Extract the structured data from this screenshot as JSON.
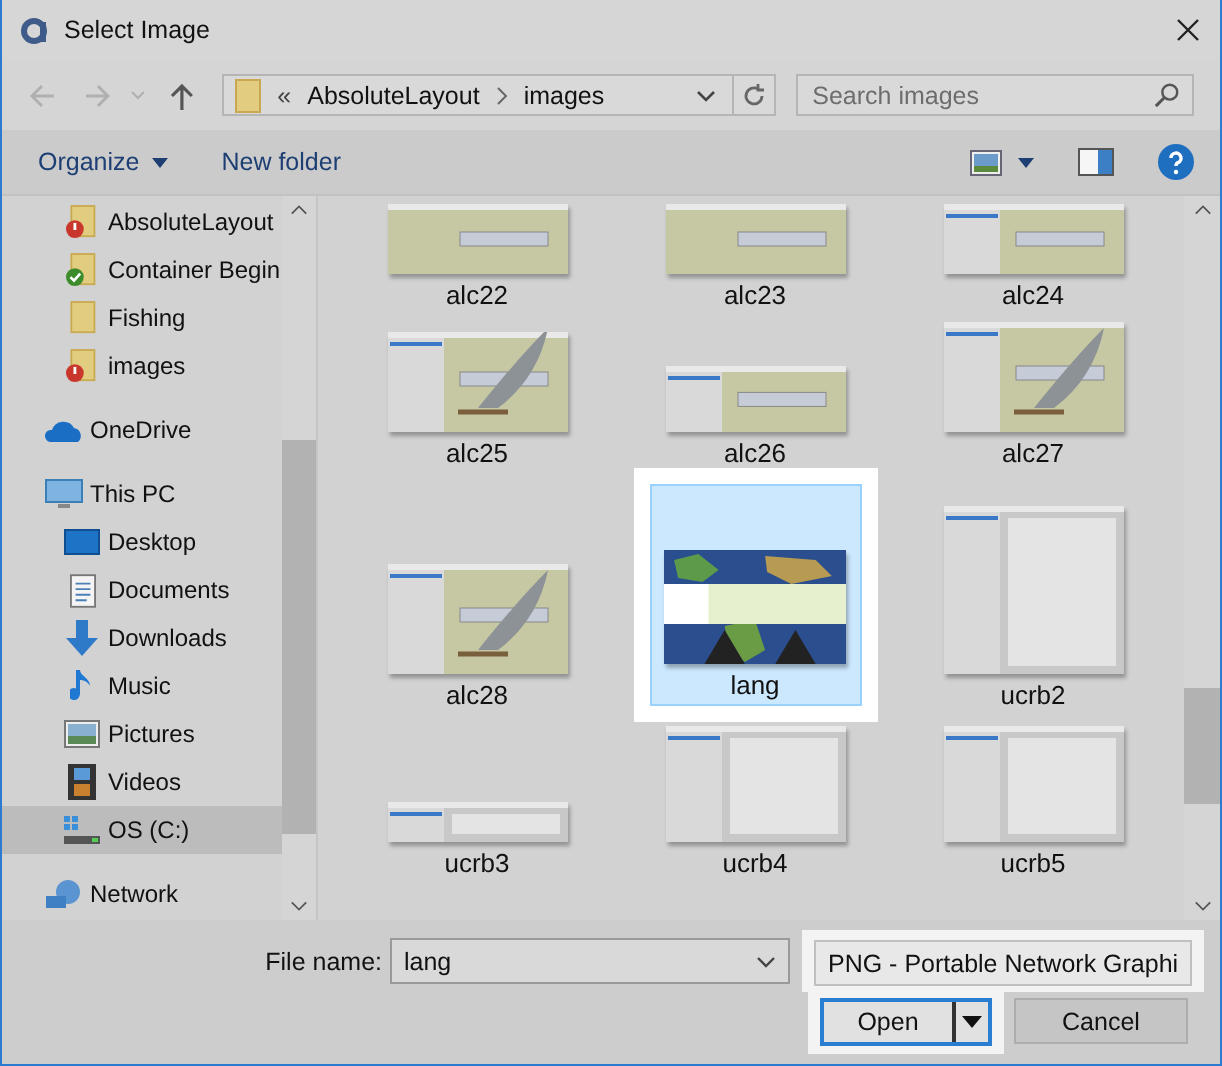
{
  "window": {
    "title": "Select Image"
  },
  "address": {
    "crumbs": [
      "«",
      "AbsoluteLayout",
      "images"
    ]
  },
  "search": {
    "placeholder": "Search images"
  },
  "toolbar": {
    "organize": "Organize",
    "new_folder": "New folder"
  },
  "sidebar": {
    "sections": [
      {
        "children": [
          {
            "label": "AbsoluteLayout",
            "kind": "folder-error",
            "selected": false
          },
          {
            "label": "Container Begin",
            "kind": "folder-ok",
            "selected": false
          },
          {
            "label": "Fishing",
            "kind": "folder",
            "selected": false
          },
          {
            "label": "images",
            "kind": "folder-error",
            "selected": false
          }
        ]
      },
      {
        "label": "OneDrive",
        "kind": "cloud",
        "selected": false
      },
      {
        "label": "This PC",
        "kind": "pc",
        "selected": false,
        "children": [
          {
            "label": "Desktop",
            "kind": "desktop",
            "selected": false
          },
          {
            "label": "Documents",
            "kind": "document",
            "selected": false
          },
          {
            "label": "Downloads",
            "kind": "download",
            "selected": false
          },
          {
            "label": "Music",
            "kind": "music",
            "selected": false
          },
          {
            "label": "Pictures",
            "kind": "pictures",
            "selected": false
          },
          {
            "label": "Videos",
            "kind": "videos",
            "selected": false
          },
          {
            "label": "OS (C:)",
            "kind": "drive",
            "selected": true
          }
        ]
      },
      {
        "label": "Network",
        "kind": "network",
        "selected": false
      }
    ]
  },
  "files": [
    {
      "name": "alc22",
      "selected": false
    },
    {
      "name": "alc23",
      "selected": false
    },
    {
      "name": "alc24",
      "selected": false
    },
    {
      "name": "alc25",
      "selected": false
    },
    {
      "name": "alc26",
      "selected": false
    },
    {
      "name": "alc27",
      "selected": false
    },
    {
      "name": "alc28",
      "selected": false
    },
    {
      "name": "lang",
      "selected": true
    },
    {
      "name": "ucrb2",
      "selected": false
    },
    {
      "name": "ucrb3",
      "selected": false
    },
    {
      "name": "ucrb4",
      "selected": false
    },
    {
      "name": "ucrb5",
      "selected": false
    }
  ],
  "file_name": {
    "label": "File name:",
    "value": "lang"
  },
  "file_type": {
    "value": "PNG - Portable Network Graphi"
  },
  "buttons": {
    "open": "Open",
    "cancel": "Cancel"
  }
}
